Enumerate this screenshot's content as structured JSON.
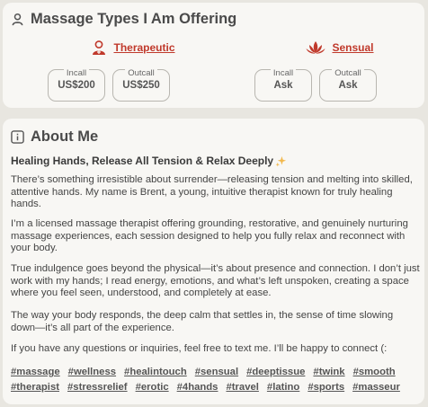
{
  "massage": {
    "title": "Massage Types I Am Offering",
    "types": [
      {
        "name": "Therapeutic",
        "incall_label": "Incall",
        "incall_value": "US$200",
        "outcall_label": "Outcall",
        "outcall_value": "US$250"
      },
      {
        "name": "Sensual",
        "incall_label": "Incall",
        "incall_value": "Ask",
        "outcall_label": "Outcall",
        "outcall_value": "Ask"
      }
    ]
  },
  "about": {
    "title": "About Me",
    "headline": "Healing Hands, Release All Tension & Relax Deeply",
    "paragraphs": [
      "There’s something irresistible about surrender—releasing tension and melting into skilled, attentive hands. My name is Brent, a young, intuitive therapist known for truly healing hands.",
      "I’m a licensed massage therapist offering grounding, restorative, and genuinely nurturing massage experiences, each session designed to help you fully relax and reconnect with your body.",
      "True indulgence goes beyond the physical—it’s about presence and connection. I don’t just work with my hands; I read energy, emotions, and what’s left unspoken, creating a space where you feel seen, understood, and completely at ease.",
      "The way your body responds, the deep calm that settles in, the sense of time slowing down—it’s all part of the experience.",
      "If you have any questions or inquiries, feel free to text me. I’ll be happy to connect (:"
    ],
    "tags": [
      "#massage",
      "#wellness",
      "#healintouch",
      "#sensual",
      "#deeptissue",
      "#twink",
      "#smooth",
      "#therapist",
      "#stressrelief",
      "#erotic",
      "#4hands",
      "#travel",
      "#latino",
      "#sports",
      "#masseur"
    ]
  },
  "colors": {
    "accent": "#c0392b",
    "background": "#e8e6e0",
    "card": "#f8f7f4"
  },
  "icons": {
    "massage_title": "masseur-icon",
    "therapeutic": "therapist-icon",
    "sensual": "lotus-icon",
    "about_title": "info-icon",
    "headline": "sparkle-icon"
  }
}
